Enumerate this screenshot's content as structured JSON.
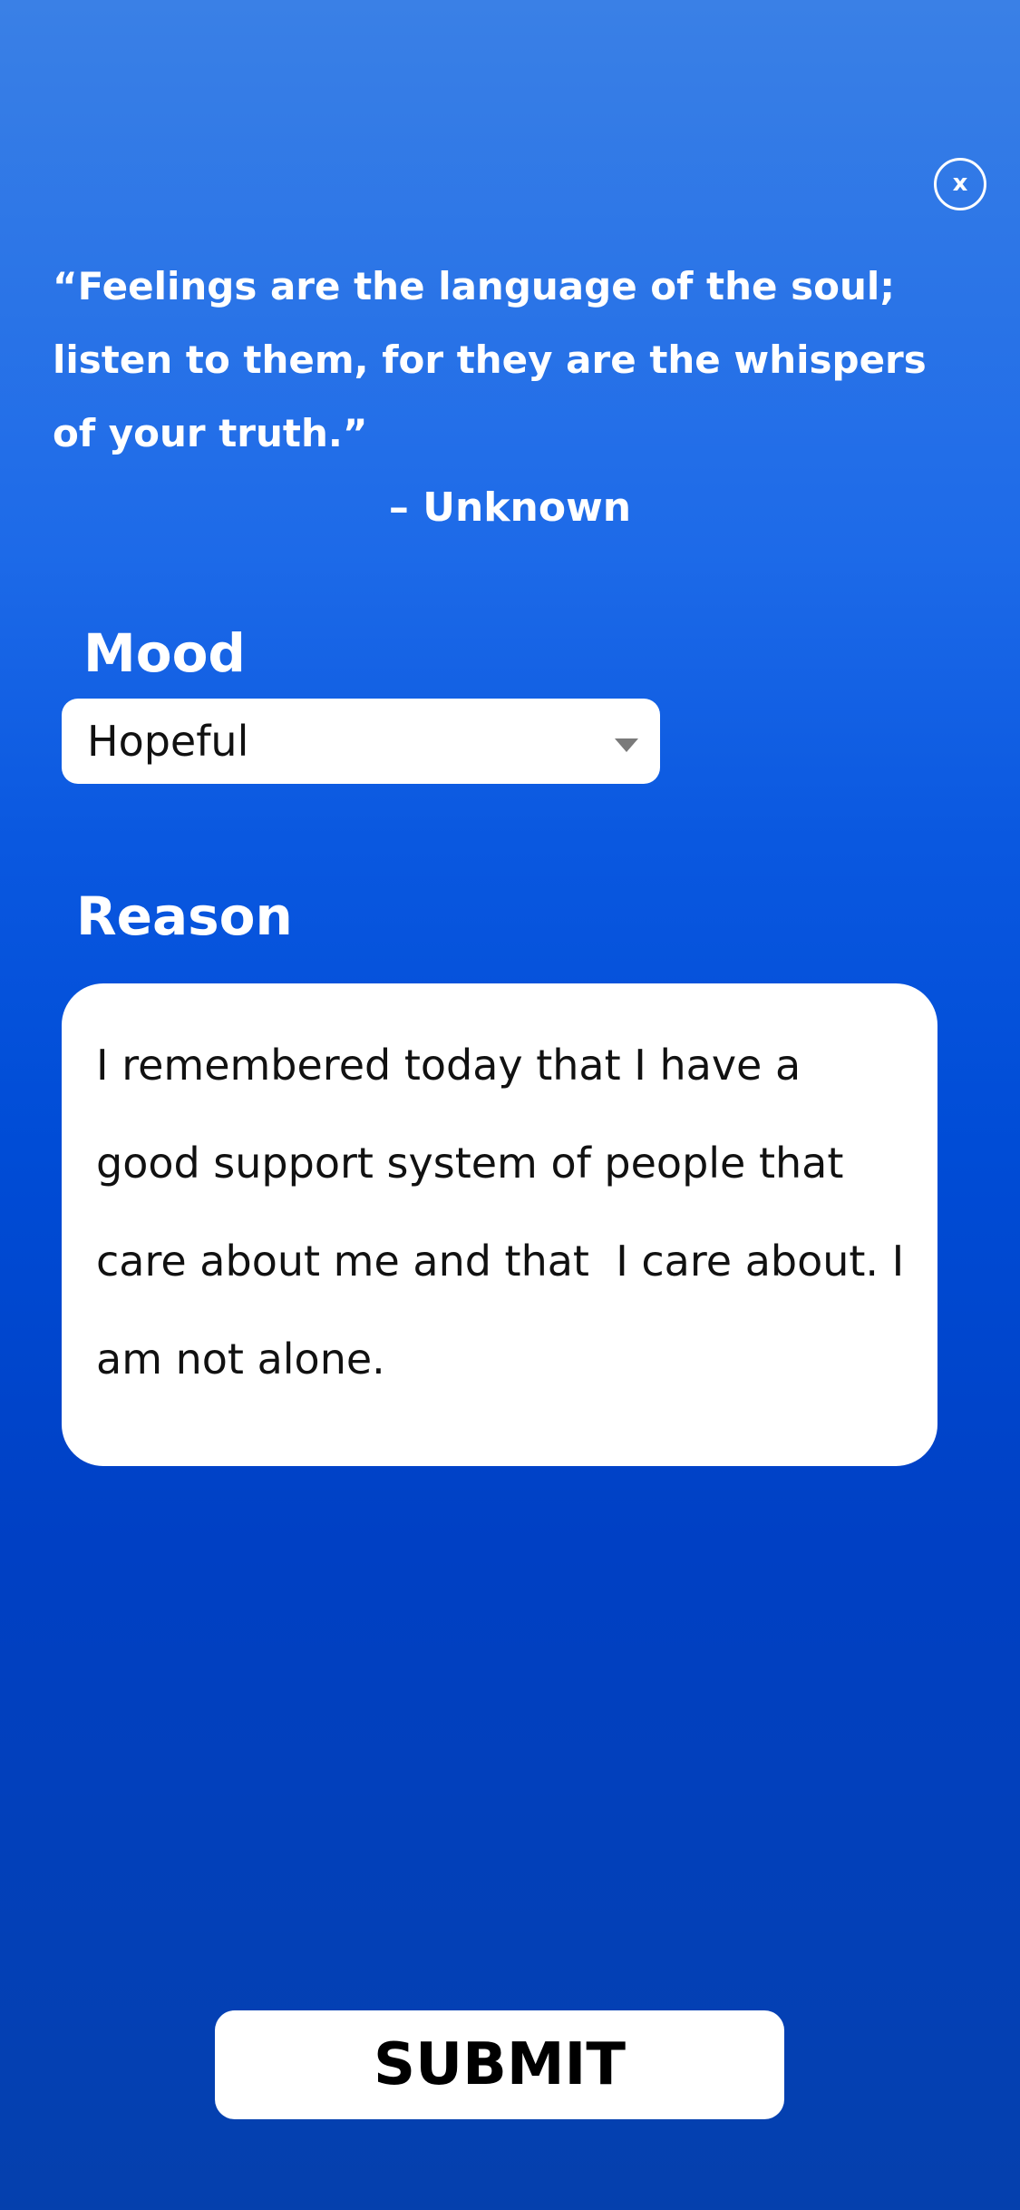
{
  "close_button": {
    "label": "x"
  },
  "quote": {
    "text": "“Feelings are the language of the soul; listen to them, for they are the whispers of your truth.”",
    "attribution": "– Unknown"
  },
  "mood": {
    "label": "Mood",
    "selected": "Hopeful"
  },
  "reason": {
    "label": "Reason",
    "value": "I remembered today that I have a good support system of people that care about me and that  I care about. I am not alone."
  },
  "submit": {
    "label": "SUBMIT"
  },
  "colors": {
    "background_top": "#3a80e6",
    "background_bottom": "#0540ad",
    "card": "#ffffff",
    "text_dark": "#111111"
  }
}
